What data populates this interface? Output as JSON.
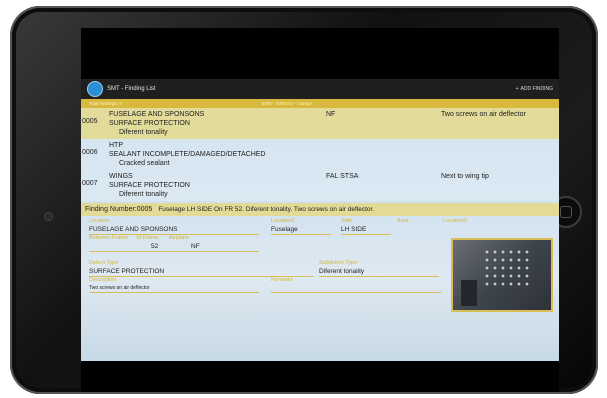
{
  "app": {
    "title": "SMT - Finding List",
    "add_finding_label": "ADD FINDING"
  },
  "list_header": {
    "col1": "Total Findings: 8",
    "col2": "8000 - 20/01/14 - Garage"
  },
  "rows": [
    {
      "num": "0005",
      "line1": "FUSELAGE AND SPONSONS",
      "line2": "SURFACE PROTECTION",
      "line3": "Diferent tonality",
      "location": "NF",
      "remarks": "Two screws on air deflector"
    },
    {
      "num": "0006",
      "line1": "HTP",
      "line2": "SEALANT INCOMPLETE/DAMAGED/DETACHED",
      "line3": "Cracked sealant",
      "location": "",
      "remarks": ""
    },
    {
      "num": "0007",
      "line1": "WINGS",
      "line2": "SURFACE PROTECTION",
      "line3": "Diferent tonality",
      "location": "FAL STSA",
      "remarks": "Next to wing tip"
    }
  ],
  "detail": {
    "finding_label": "Finding Number:0005",
    "summary": "Fuselage LH SIDE On FR 52. Diferent tonality. Two screws on air deflector."
  },
  "form": {
    "location_label": "Location",
    "location_value": "FUSELAGE AND SPONSONS",
    "location2_label": "Location2",
    "location2_value": "Fuselage",
    "side_label": "Side",
    "side_value": "LH SIDE",
    "area_label": "Area",
    "location3_label": "Location3",
    "between_label": "Between Frame",
    "stframe_label": "St Frame",
    "airplane_label": "Airplane",
    "between_value": "52",
    "airplane_value": "NF",
    "defect_label": "Defect Type",
    "defect_value": "SURFACE PROTECTION",
    "subdefect_label": "Subdefect Type",
    "subdefect_value": "Diferent tonality",
    "description_label": "Description",
    "remarks_label": "Remarks",
    "description_value": "Two screws on air deflector"
  },
  "colors": {
    "accent": "#d9b93d",
    "titlebar": "#1f1f1f"
  }
}
